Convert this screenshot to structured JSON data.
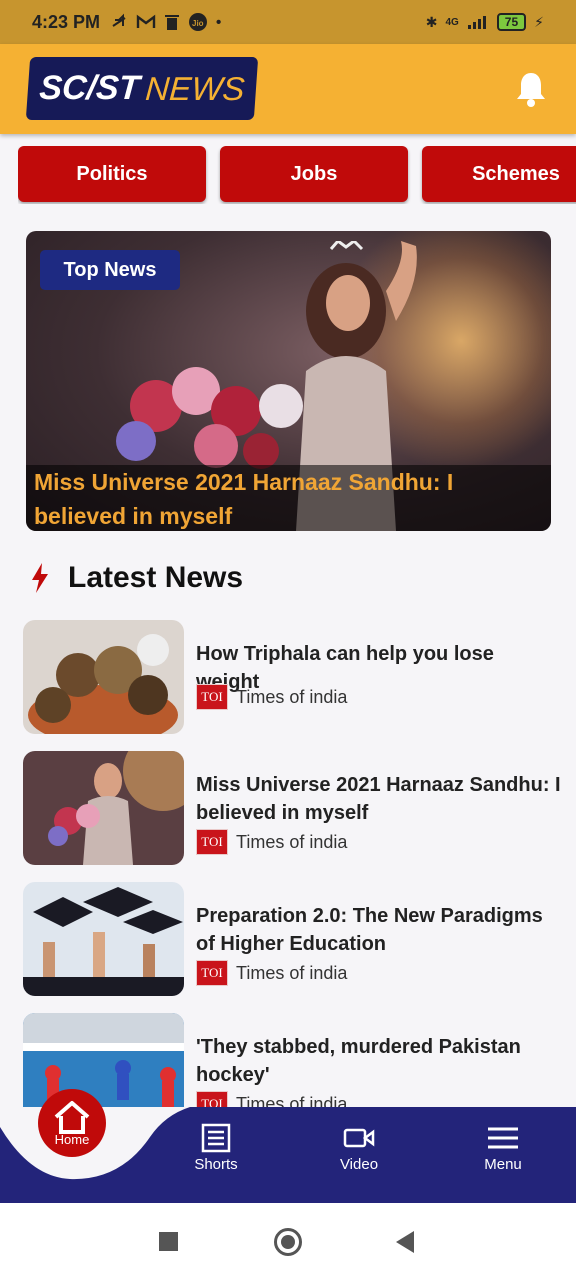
{
  "status": {
    "time": "4:23 PM",
    "battery": "75",
    "network": "4G"
  },
  "header": {
    "logo_main": "SC/ST",
    "logo_accent": "NEWS"
  },
  "categories": [
    {
      "label": "Politics"
    },
    {
      "label": "Jobs"
    },
    {
      "label": "Schemes"
    }
  ],
  "hero": {
    "badge": "Top News",
    "title": "Miss Universe 2021 Harnaaz Sandhu: I believed in myself"
  },
  "latest": {
    "heading": "Latest News",
    "items": [
      {
        "title": "How Triphala can help you lose weight",
        "source": "Times of india",
        "source_logo": "TOI"
      },
      {
        "title": "Miss Universe 2021 Harnaaz Sandhu: I believed in myself",
        "source": "Times of india",
        "source_logo": "TOI"
      },
      {
        "title": "Preparation 2.0: The New Paradigms of Higher Education",
        "source": "Times of india",
        "source_logo": "TOI"
      },
      {
        "title": "'They stabbed, murdered Pakistan hockey'",
        "source": "Times of india",
        "source_logo": "TOI"
      }
    ]
  },
  "nav": {
    "home": "Home",
    "shorts": "Shorts",
    "video": "Video",
    "menu": "Menu"
  },
  "colors": {
    "header_bg": "#f5b133",
    "category_red": "#c00a0a",
    "nav_bg": "#23247a",
    "badge_bg": "#1e2a82",
    "caption_text": "#f0a535"
  }
}
